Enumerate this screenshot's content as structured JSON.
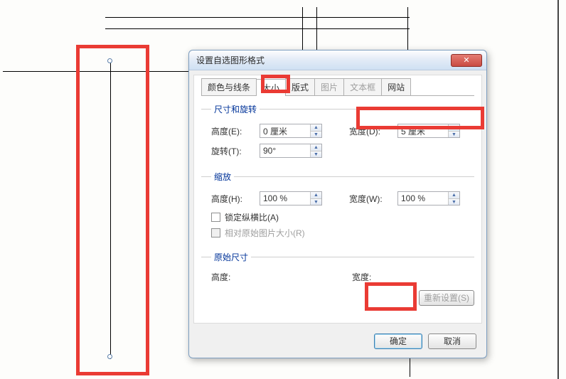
{
  "dialog": {
    "title": "设置自选图形格式",
    "tabs": {
      "colors_lines": "颜色与线条",
      "size": "大小",
      "layout": "版式",
      "picture": "图片",
      "textbox": "文本框",
      "web": "网站"
    },
    "size_rotation": {
      "legend": "尺寸和旋转",
      "height_label": "高度(E):",
      "height_value": "0 厘米",
      "width_label": "宽度(D):",
      "width_value": "5 厘米",
      "rotation_label": "旋转(T):",
      "rotation_value": "90°"
    },
    "scale": {
      "legend": "缩放",
      "height_label": "高度(H):",
      "height_value": "100 %",
      "width_label": "宽度(W):",
      "width_value": "100 %",
      "lock_aspect": "锁定纵横比(A)",
      "relative_original": "相对原始图片大小(R)"
    },
    "original": {
      "legend": "原始尺寸",
      "height_label": "高度:",
      "width_label": "宽度:"
    },
    "reset_button": "重新设置(S)",
    "ok_button": "确定",
    "cancel_button": "取消"
  }
}
